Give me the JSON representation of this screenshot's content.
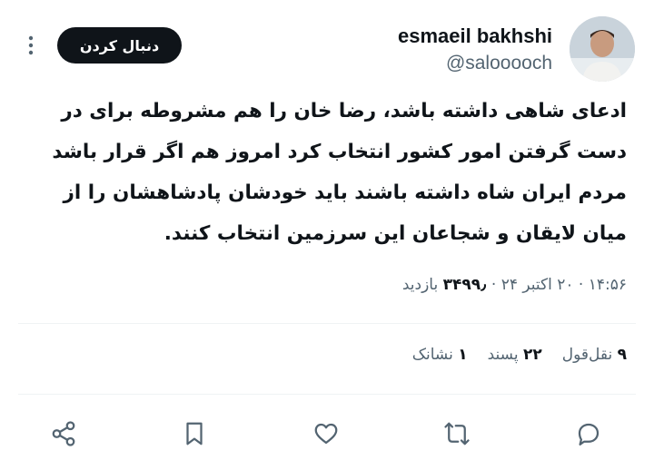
{
  "user": {
    "name": "esmaeil bakhshi",
    "handle": "@salooooch"
  },
  "follow_button": {
    "label": "دنبال کردن"
  },
  "tweet": {
    "text": "ادعای شاهی داشته باشد، رضا خان را هم مشروطه برای در دست گرفتن امور کشور انتخاب کرد امروز هم اگر قرار باشد مردم ایران شاه داشته باشند باید خودشان پادشاهشان را از میان لایقان و شجاعان این سرزمین انتخاب کنند."
  },
  "meta": {
    "time": "۱۴:۵۶",
    "separator": "·",
    "date": "۲۰ اکتبر ۲۴",
    "views": "۳۴۹۹٫",
    "views_label": "بازدید"
  },
  "stats": {
    "quotes_count": "۹",
    "quotes_label": "نقل‌قول",
    "likes_count": "۲۲",
    "likes_label": "پسند",
    "bookmarks_count": "۱",
    "bookmarks_label": "نشانک"
  },
  "actions": [
    "reply-icon",
    "retweet-icon",
    "like-icon",
    "bookmark-icon",
    "share-icon"
  ],
  "colors": {
    "text": "#0f1419",
    "secondary": "#536471",
    "divider": "#eff3f4",
    "button_bg": "#0f1419"
  }
}
